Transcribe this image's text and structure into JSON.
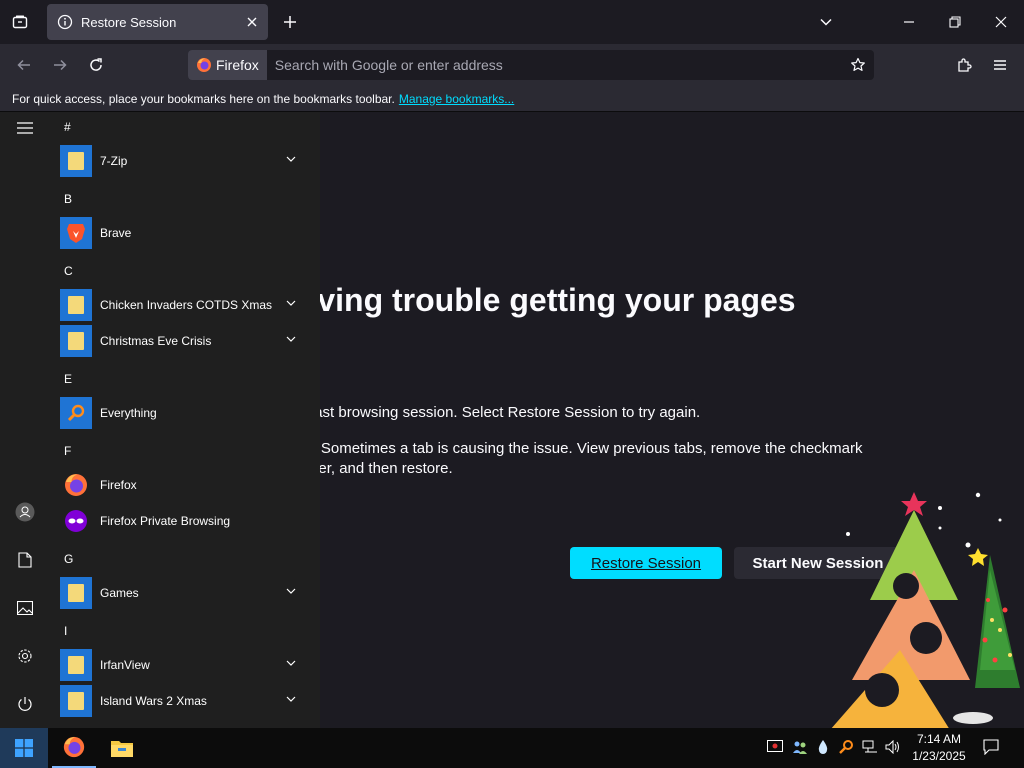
{
  "tabbar": {
    "tab_title": "Restore Session"
  },
  "navbar": {
    "identity_label": "Firefox",
    "url_placeholder": "Search with Google or enter address"
  },
  "bookmarks_bar": {
    "text": "For quick access, place your bookmarks here on the bookmarks toolbar.",
    "link": "Manage bookmarks..."
  },
  "page": {
    "heading": "having trouble getting your pages",
    "p1": "g your last browsing session. Select Restore Session to try again.",
    "p2_line1": "ession? Sometimes a tab is causing the issue. View previous tabs, remove the checkmark",
    "p2_line2": "to recover, and then restore.",
    "restore_button": "Restore Session",
    "new_session_button": "Start New Session",
    "accent_color": "#00ddff"
  },
  "start_menu": {
    "sections": [
      {
        "letter": "#",
        "items": [
          {
            "label": "7-Zip",
            "icon": "folder-icon",
            "expandable": true
          }
        ]
      },
      {
        "letter": "B",
        "items": [
          {
            "label": "Brave",
            "icon": "brave-icon",
            "expandable": false
          }
        ]
      },
      {
        "letter": "C",
        "items": [
          {
            "label": "Chicken Invaders COTDS Xmas",
            "icon": "folder-icon",
            "expandable": true
          },
          {
            "label": "Christmas Eve Crisis",
            "icon": "folder-icon",
            "expandable": true
          }
        ]
      },
      {
        "letter": "E",
        "items": [
          {
            "label": "Everything",
            "icon": "search-icon",
            "expandable": false
          }
        ]
      },
      {
        "letter": "F",
        "items": [
          {
            "label": "Firefox",
            "icon": "firefox-icon",
            "expandable": false
          },
          {
            "label": "Firefox Private Browsing",
            "icon": "private-browsing-icon",
            "expandable": false
          }
        ]
      },
      {
        "letter": "G",
        "items": [
          {
            "label": "Games",
            "icon": "folder-icon",
            "expandable": true
          }
        ]
      },
      {
        "letter": "I",
        "items": [
          {
            "label": "IrfanView",
            "icon": "folder-icon",
            "expandable": true
          },
          {
            "label": "Island Wars 2 Xmas",
            "icon": "folder-icon",
            "expandable": true
          }
        ]
      }
    ]
  },
  "taskbar": {
    "time": "7:14 AM",
    "date": "1/23/2025"
  }
}
